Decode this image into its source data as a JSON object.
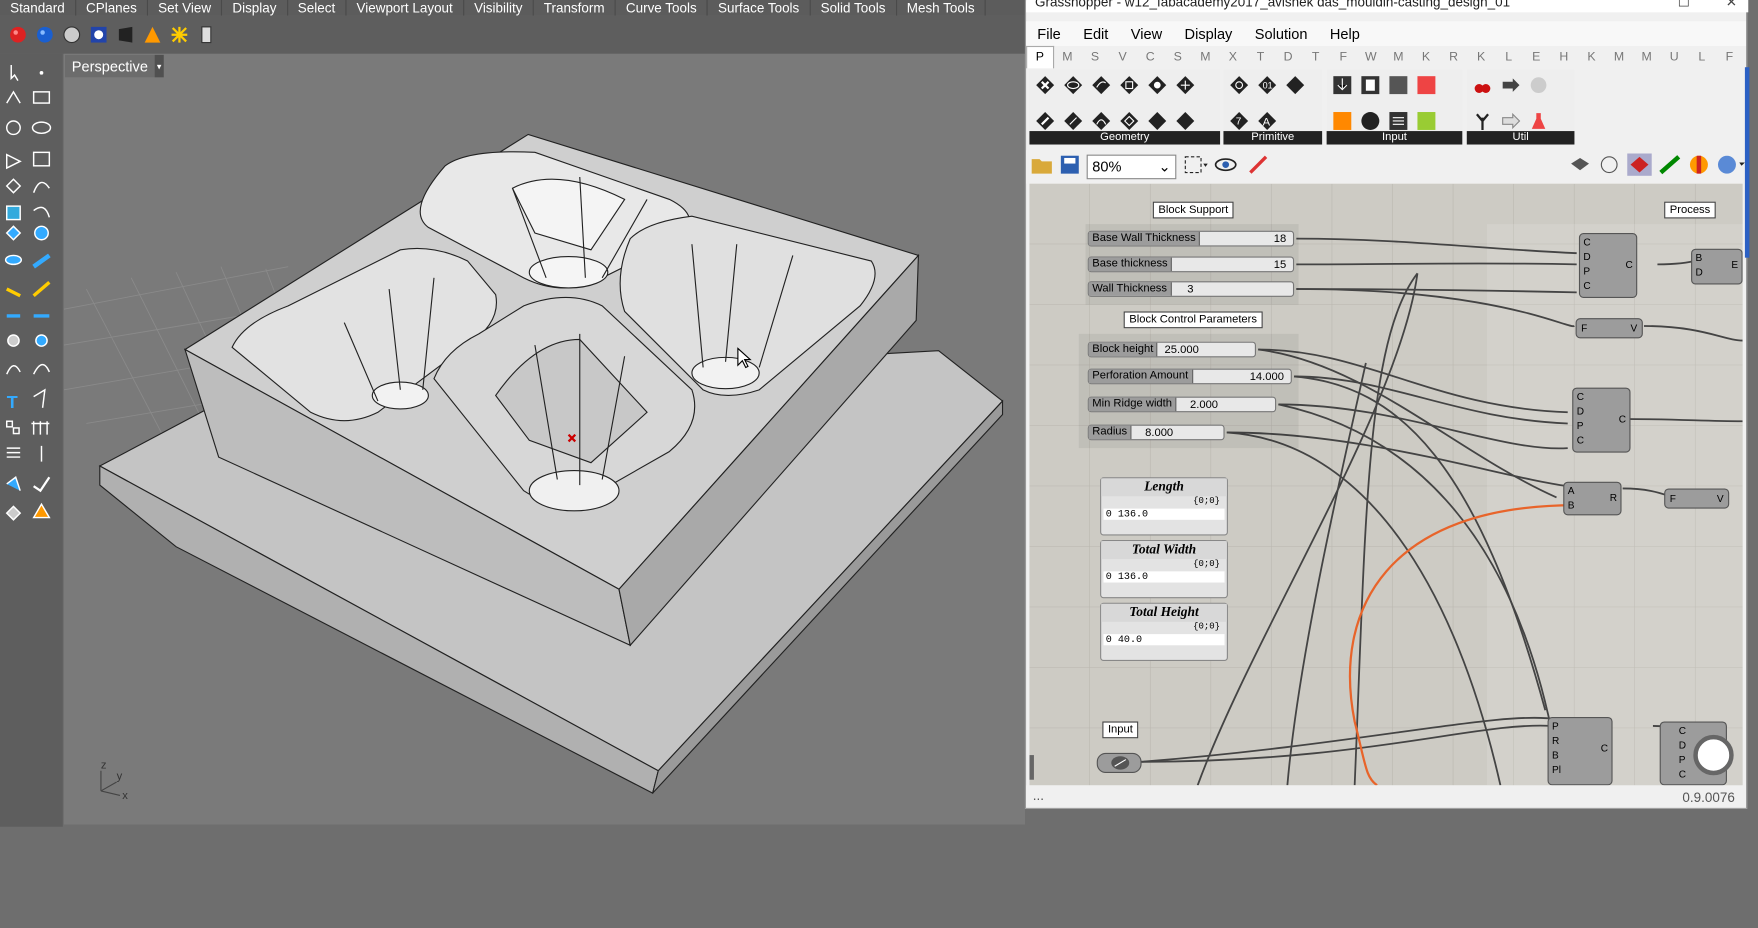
{
  "rhino": {
    "tabs": [
      "Standard",
      "CPlanes",
      "Set View",
      "Display",
      "Select",
      "Viewport Layout",
      "Visibility",
      "Transform",
      "Curve Tools",
      "Surface Tools",
      "Solid Tools",
      "Mesh Tools"
    ],
    "viewport_label": "Perspective",
    "axis_z": "z",
    "axis_y": "y",
    "axis_x": "x"
  },
  "grasshopper": {
    "title": "Grasshopper - w12_fabacademy2017_avishek das_mouldin-casting_design_01",
    "menu": [
      "File",
      "Edit",
      "View",
      "Display",
      "Solution",
      "Help"
    ],
    "tab_letters": [
      "P",
      "M",
      "S",
      "V",
      "C",
      "S",
      "M",
      "X",
      "T",
      "D",
      "T",
      "F",
      "W",
      "M",
      "K",
      "R",
      "K",
      "L",
      "E",
      "H",
      "K",
      "M",
      "M",
      "U",
      "L",
      "F"
    ],
    "panel_groups": [
      "Geometry",
      "Primitive",
      "Input",
      "Util"
    ],
    "zoom": "80%",
    "version": "0.9.0076",
    "status_dots": "...",
    "groups": {
      "block_support": "Block Support",
      "block_control": "Block Control Parameters",
      "process": "Process",
      "input": "Input"
    },
    "sliders": [
      {
        "label": "Base Wall Thickness",
        "value": "18"
      },
      {
        "label": "Base thickness",
        "value": "15"
      },
      {
        "label": "Wall Thickness",
        "value": "3"
      },
      {
        "label": "Block height",
        "value": "25.000"
      },
      {
        "label": "Perforation Amount",
        "value": "14.000"
      },
      {
        "label": "Min Ridge width",
        "value": "2.000"
      },
      {
        "label": "Radius",
        "value": "8.000"
      }
    ],
    "panels": [
      {
        "title": "Length",
        "index": "{0;0}",
        "row": "0",
        "value": "136.0"
      },
      {
        "title": "Total Width",
        "index": "{0;0}",
        "row": "0",
        "value": "136.0"
      },
      {
        "title": "Total Height",
        "index": "{0;0}",
        "row": "0",
        "value": "40.0"
      }
    ],
    "node_pins": {
      "cdpc": [
        "C",
        "D",
        "P",
        "C"
      ],
      "bd": [
        "B",
        "D"
      ],
      "ab": [
        "A",
        "B"
      ],
      "prbpl": [
        "P",
        "R",
        "B",
        "Pl"
      ],
      "f": "F",
      "v": "V",
      "c": "C",
      "r": "R",
      "e": "E"
    }
  },
  "colors": {
    "wire_highlight": "#e8642a",
    "wire": "#444444",
    "viewport_bg": "#7a7a7a",
    "grid_bg": "#cdcbc4"
  }
}
